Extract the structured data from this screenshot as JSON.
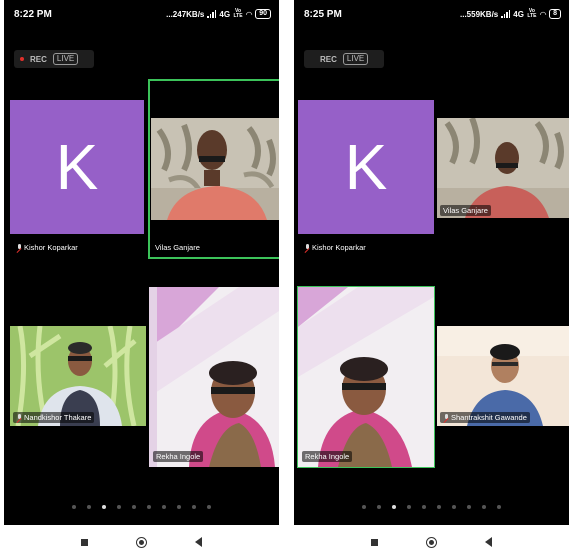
{
  "left": {
    "time": "8:22 PM",
    "network": "...247KB/s",
    "battery": "90",
    "rec": "REC",
    "live": "LIVE",
    "tiles": {
      "k_initial": "K",
      "kishor": "Kishor Koparkar",
      "vilas": "Vilas Ganjare",
      "nandkishor": "Nandkishor Thakare",
      "rekha": "Rekha Ingole"
    },
    "page_dots": 10,
    "active_dot": 2
  },
  "right": {
    "time": "8:25 PM",
    "network": "...559KB/s",
    "battery": "8",
    "rec": "REC",
    "live": "LIVE",
    "tiles": {
      "k_initial": "K",
      "kishor": "Kishor Koparkar",
      "vilas": "Vilas Ganjare",
      "rekha": "Rekha Ingole",
      "shantrakshit": "Shantrakshit Gawande"
    },
    "page_dots": 10,
    "active_dot": 2
  },
  "status_icons": [
    "signal-icon",
    "lte-icon",
    "wifi-icon",
    "battery-icon"
  ],
  "network_type": "4G",
  "colors": {
    "avatar_bg": "#9660c8",
    "active_border": "#3cc35a",
    "rec_dot": "#e0302b"
  }
}
